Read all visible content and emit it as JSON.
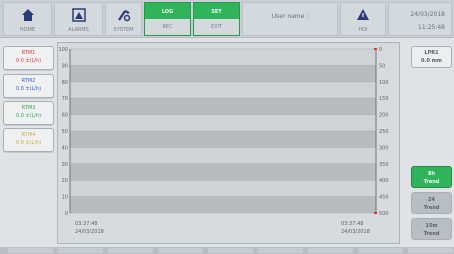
{
  "topbar": {
    "home_label": "HOME",
    "alarms_label": "ALARMS",
    "system_label": "SYSTEM",
    "rec_top": "LOG",
    "rec_label": "REC",
    "exit_top": "SET",
    "exit_label": "EXIT",
    "user_text": "User name :",
    "hdl_label": "HDI",
    "date": "24/03/2018",
    "time": "11:25:48"
  },
  "colors": {
    "green": "#2fb35b",
    "series1": "#e03a3a",
    "series2": "#3a5be0",
    "series3": "#36a64f",
    "series4": "#c9b13a"
  },
  "left_cards": [
    {
      "name": "RTM1",
      "value": "0.0 ±(L/h)",
      "color": "#e03a3a"
    },
    {
      "name": "RTM2",
      "value": "0.0 ±(L/h)",
      "color": "#3a5be0"
    },
    {
      "name": "RTM3",
      "value": "0.0 ±(L/h)",
      "color": "#36a64f"
    },
    {
      "name": "RTM4",
      "value": "0.0 ±(L/h)",
      "color": "#c9b13a"
    }
  ],
  "right_panel": {
    "top_line1": "LPR1",
    "top_line2": "0.0 mm",
    "trend_buttons": [
      {
        "line1": "8h",
        "line2": "Trend",
        "selected": true
      },
      {
        "line1": "24",
        "line2": "Trend",
        "selected": false
      },
      {
        "line1": "15m",
        "line2": "Trend",
        "selected": false
      }
    ]
  },
  "chart_data": {
    "type": "line",
    "title": "",
    "xlabel": "",
    "ylabel": "",
    "left_axis": {
      "ylim": [
        0,
        100
      ],
      "ticks": [
        "100",
        "90",
        "80",
        "70",
        "60",
        "50",
        "40",
        "30",
        "20",
        "10",
        "0"
      ]
    },
    "right_axis": {
      "ylim": [
        0,
        500
      ],
      "ticks": [
        "0",
        "50",
        "100",
        "150",
        "200",
        "250",
        "300",
        "350",
        "400",
        "450",
        "500"
      ]
    },
    "x_start": {
      "time": "03:37:48",
      "date": "24/03/2018"
    },
    "x_end": {
      "time": "03:37:48",
      "date": "24/03/2018"
    },
    "series": [],
    "grid": true
  }
}
